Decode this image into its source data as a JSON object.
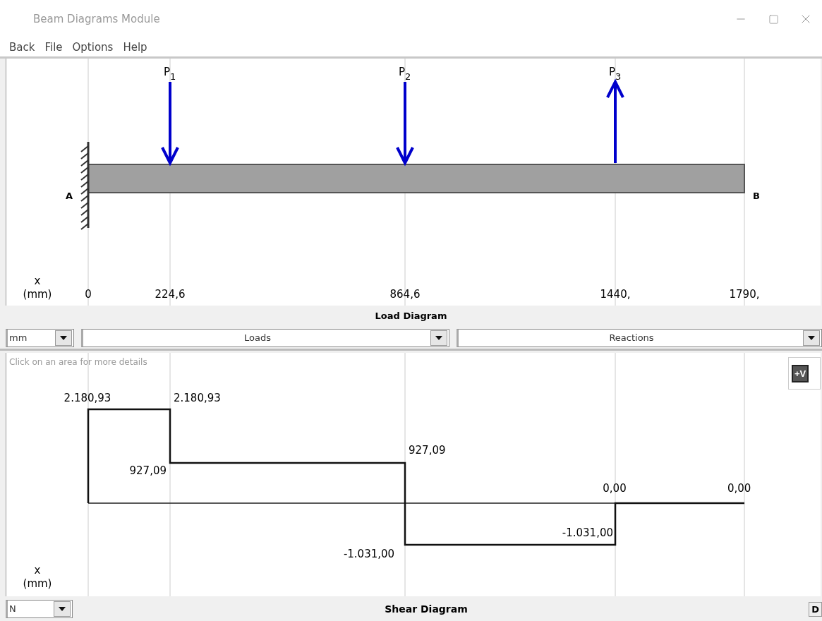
{
  "window": {
    "title": "Beam Diagrams Module"
  },
  "menu": [
    "Back",
    "File",
    "Options",
    "Help"
  ],
  "beam": {
    "left_support": "A",
    "right_end": "B",
    "loads": [
      {
        "name": "P",
        "index": "1",
        "kind": "down"
      },
      {
        "name": "P",
        "index": "2",
        "kind": "down"
      },
      {
        "name": "P",
        "index": "3",
        "kind": "up"
      }
    ],
    "axis_label": [
      "x",
      "(mm)"
    ],
    "positions": [
      "0",
      "224,6",
      "864,6",
      "1440,",
      "1790,"
    ]
  },
  "load_panel_title": "Load Diagram",
  "controls": {
    "unit": "mm",
    "loads": "Loads",
    "reactions": "Reactions"
  },
  "shear": {
    "hint": "Click on an area for more details",
    "sign_button": "+V",
    "labels": [
      "2.180,93",
      "2.180,93",
      "927,09",
      "927,09",
      "0,00",
      "0,00",
      "-1.031,00",
      "-1.031,00"
    ],
    "axis_label": [
      "x",
      "(mm)"
    ]
  },
  "bottom": {
    "unit": "N",
    "title": "Shear Diagram",
    "button": "D"
  }
}
